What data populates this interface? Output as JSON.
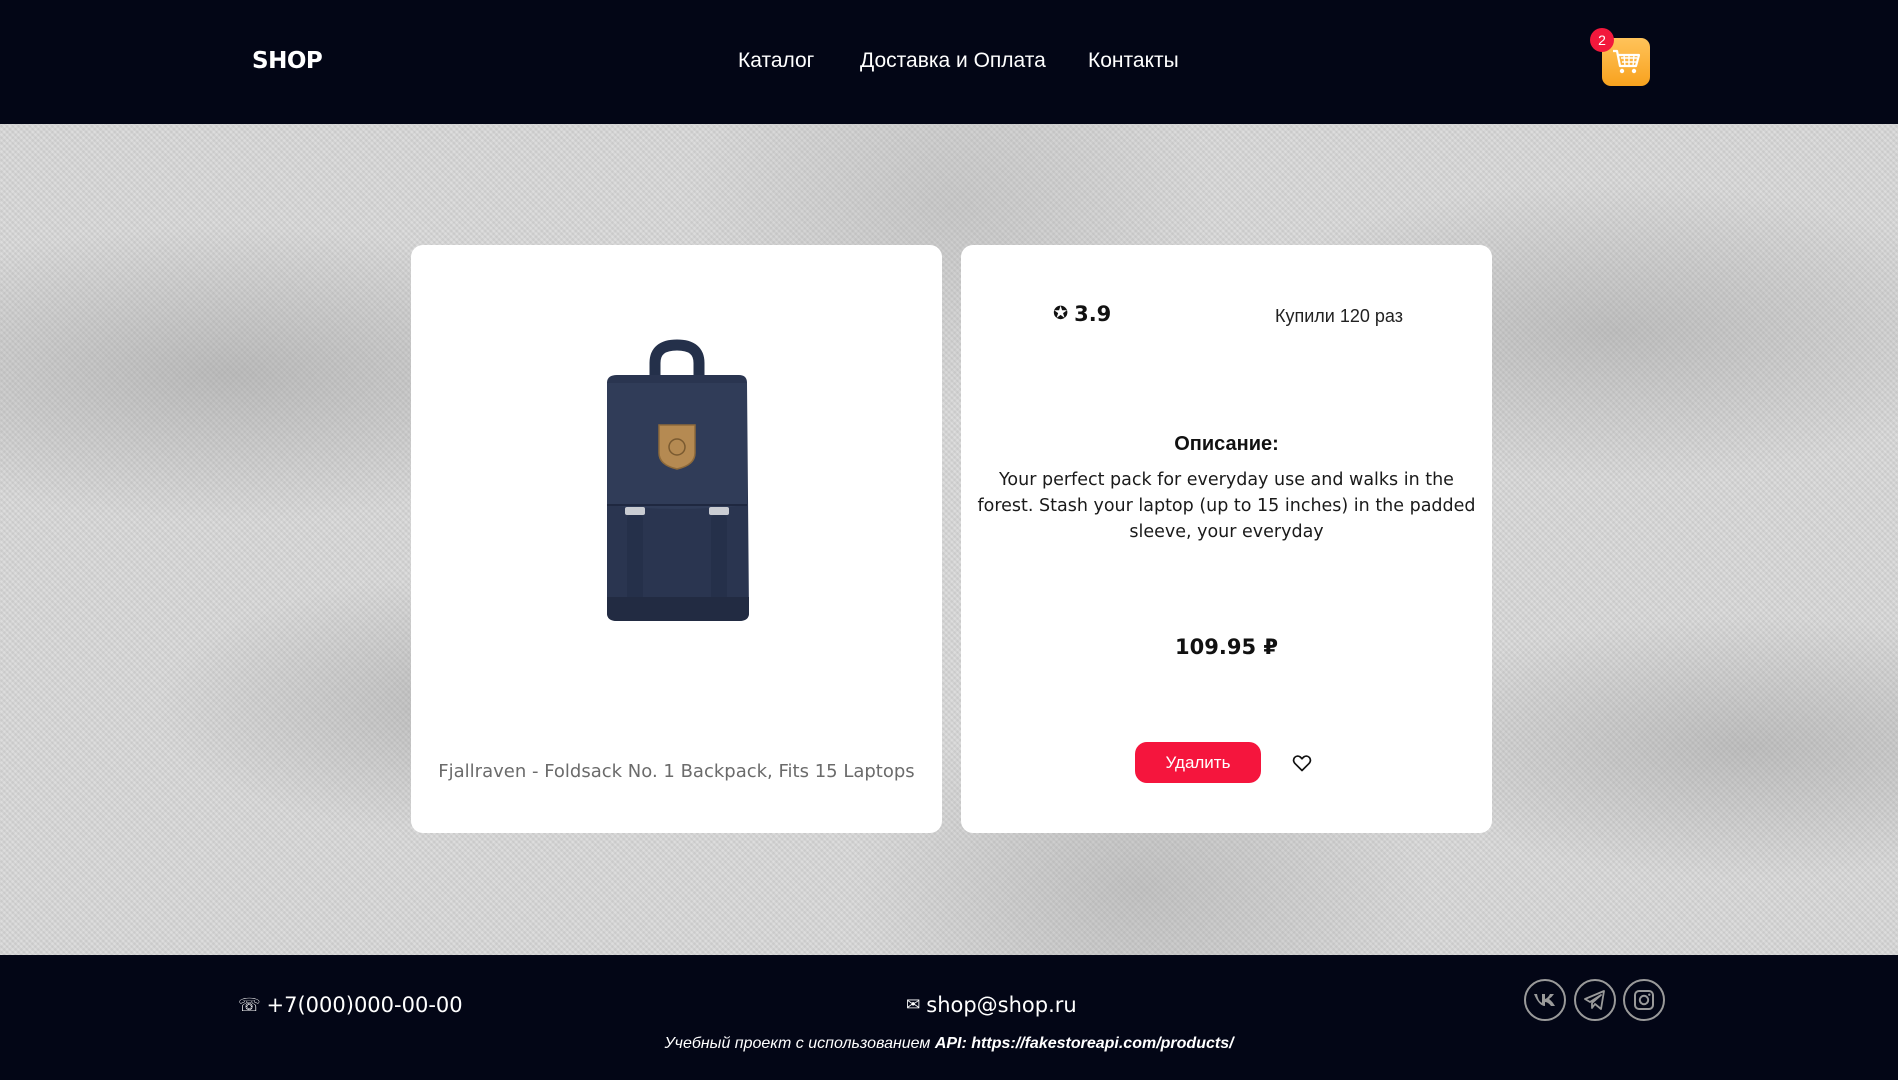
{
  "header": {
    "logo": "SHOP",
    "nav": [
      "Каталог",
      "Доставка и Оплата",
      "Контакты"
    ],
    "cart_count": "2"
  },
  "product": {
    "title": "Fjallraven - Foldsack No. 1 Backpack, Fits 15 Laptops",
    "rating": "3.9",
    "bought": "Купили 120 раз",
    "description_title": "Описание:",
    "description": "Your perfect pack for everyday use and walks in the forest. Stash your laptop (up to 15 inches) in the padded sleeve, your everyday",
    "price": "109.95 ₽",
    "delete_label": "Удалить"
  },
  "footer": {
    "phone": "+7(000)000-00-00",
    "email": "shop@shop.ru",
    "credit_prefix": "Учебный проект с использованием ",
    "credit_api_label": "API:",
    "credit_link": "https://fakestoreapi.com/products/"
  },
  "colors": {
    "header_bg": "#030616",
    "accent_red": "#f5153d",
    "cart_orange": "#f8a21e",
    "card_bg": "#ffffff"
  },
  "icons": [
    "star-icon",
    "cart-icon",
    "heart-icon",
    "phone-icon",
    "mail-icon",
    "vk-icon",
    "telegram-icon",
    "instagram-icon"
  ]
}
